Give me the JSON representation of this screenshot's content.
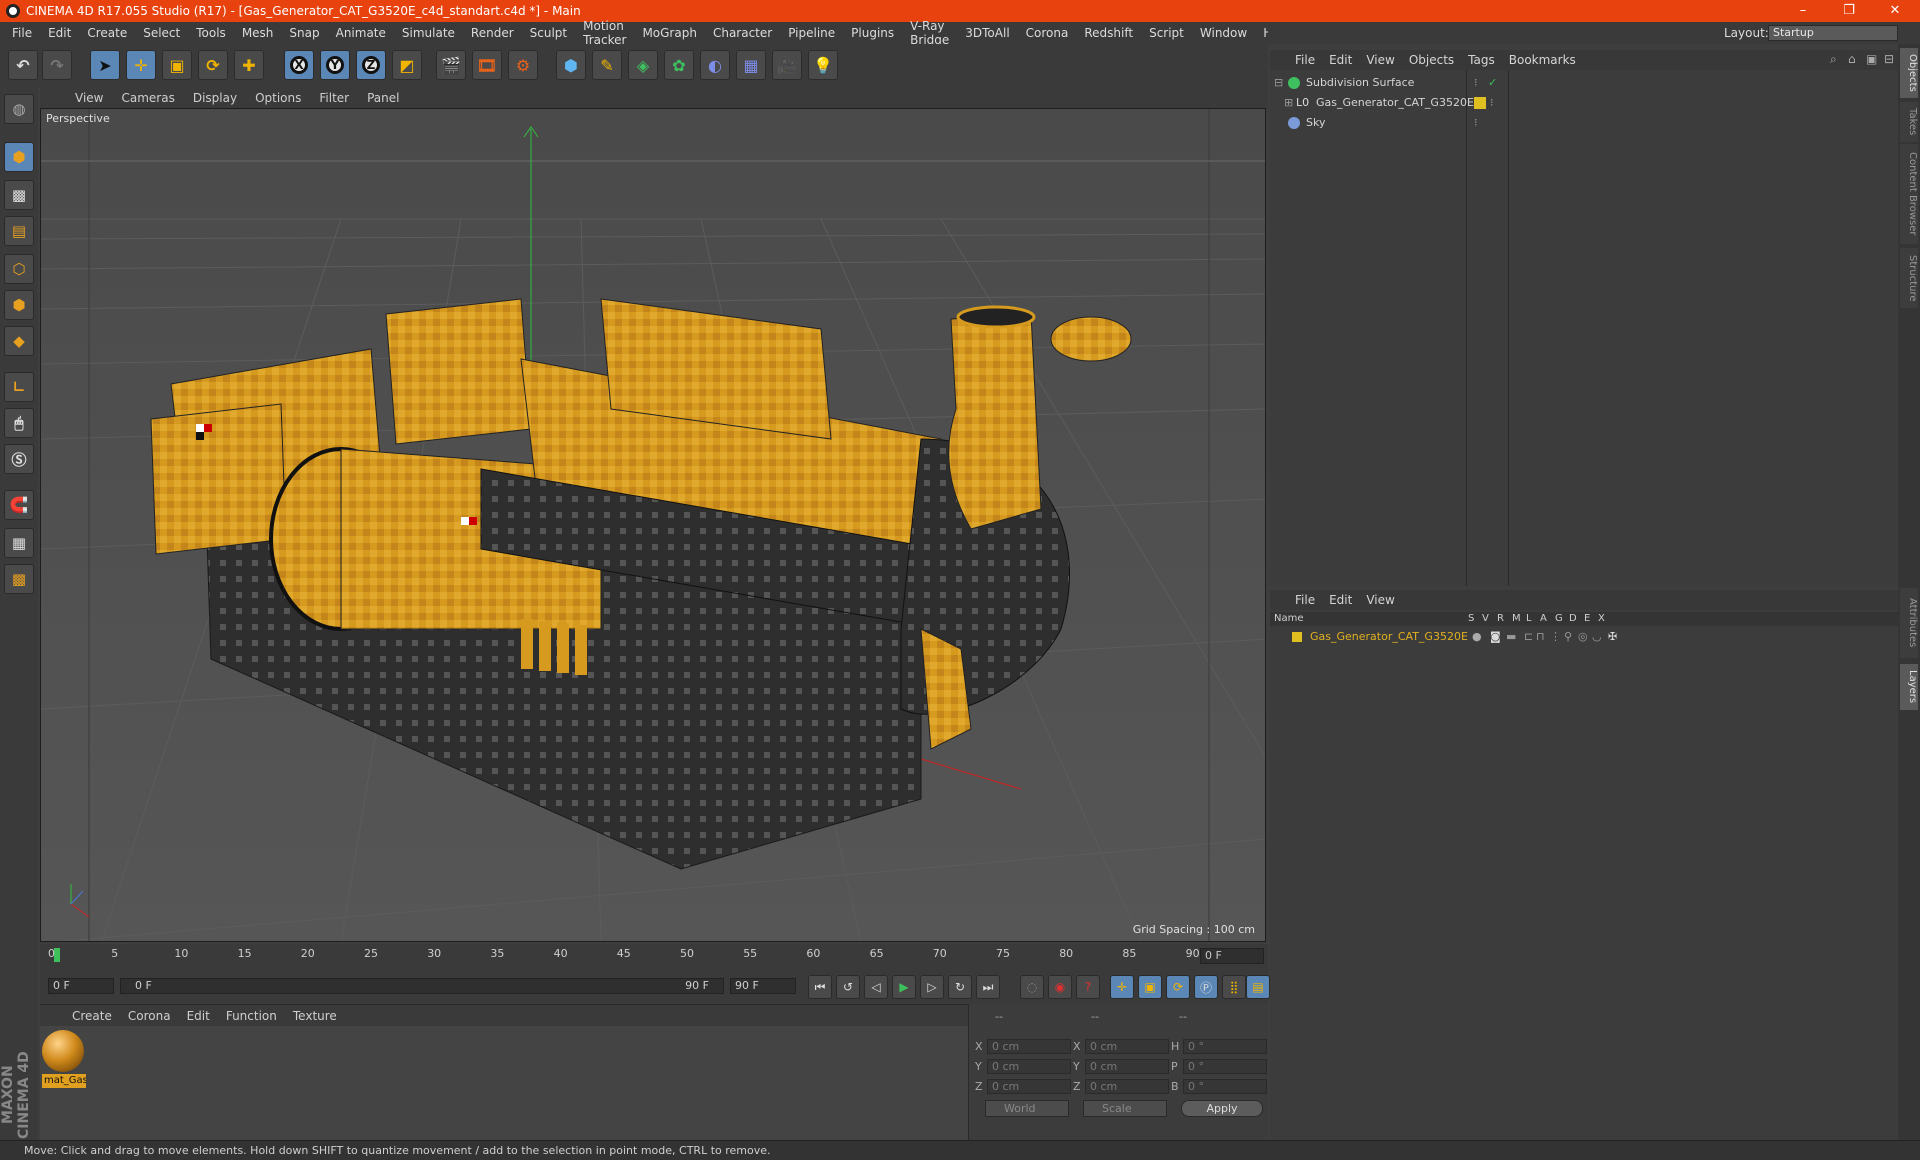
{
  "window": {
    "title": "CINEMA 4D R17.055 Studio (R17) - [Gas_Generator_CAT_G3520E_c4d_standart.c4d *] - Main",
    "minimize": "–",
    "maximize": "❐",
    "close": "✕"
  },
  "menubar": [
    "File",
    "Edit",
    "Create",
    "Select",
    "Tools",
    "Mesh",
    "Snap",
    "Animate",
    "Simulate",
    "Render",
    "Sculpt",
    "Motion Tracker",
    "MoGraph",
    "Character",
    "Pipeline",
    "Plugins",
    "V-Ray Bridge",
    "3DToAll",
    "Corona",
    "Redshift",
    "Script",
    "Window",
    "Help"
  ],
  "layout": {
    "label": "Layout:",
    "value": "Startup"
  },
  "toolbar": {
    "axis_x": "X",
    "axis_y": "Y",
    "axis_z": "Z"
  },
  "viewport": {
    "menu": [
      "View",
      "Cameras",
      "Display",
      "Options",
      "Filter",
      "Panel"
    ],
    "label": "Perspective",
    "grid_spacing": "Grid Spacing : 100 cm"
  },
  "timeline": {
    "ticks": [
      "0",
      "5",
      "10",
      "15",
      "20",
      "25",
      "30",
      "35",
      "40",
      "45",
      "50",
      "55",
      "60",
      "65",
      "70",
      "75",
      "80",
      "85",
      "90"
    ],
    "current_frame": "0 F"
  },
  "transport": {
    "start": "0 F",
    "range_start": "0 F",
    "range_end": "90 F",
    "end": "90 F"
  },
  "material_menu": [
    "Create",
    "Corona",
    "Edit",
    "Function",
    "Texture"
  ],
  "material": {
    "name": "mat_Gas"
  },
  "coords": {
    "header": "--",
    "x_pos": "0 cm",
    "y_pos": "0 cm",
    "z_pos": "0 cm",
    "x_size": "0 cm",
    "y_size": "0 cm",
    "z_size": "0 cm",
    "h": "0 °",
    "p": "0 °",
    "b": "0 °",
    "lbl_x": "X",
    "lbl_y": "Y",
    "lbl_z": "Z",
    "lbl_h": "H",
    "lbl_p": "P",
    "lbl_b": "B",
    "mode": "World",
    "size_mode": "Scale",
    "apply": "Apply"
  },
  "objects": {
    "menu": [
      "File",
      "Edit",
      "View",
      "Objects",
      "Tags",
      "Bookmarks"
    ],
    "items": [
      "Subdivision Surface",
      "Gas_Generator_CAT_G3520E",
      "Sky"
    ]
  },
  "layers": {
    "menu": [
      "File",
      "Edit",
      "View"
    ],
    "headers": [
      "Name",
      "S",
      "V",
      "R",
      "M",
      "L",
      "A",
      "G",
      "D",
      "E",
      "X"
    ],
    "items": [
      "Gas_Generator_CAT_G3520E"
    ]
  },
  "right_tabs": [
    "Objects",
    "Takes",
    "Content Browser",
    "Structure",
    "Attributes",
    "Layers"
  ],
  "maxon": "MAXON CINEMA 4D",
  "status": "Move: Click and drag to move elements. Hold down SHIFT to quantize movement / add to the selection in point mode, CTRL to remove.",
  "colors": {
    "titlebar": "#e8420f",
    "accent": "#5b87b6",
    "generator": "#d69a1e",
    "layer": "#e0c020"
  }
}
